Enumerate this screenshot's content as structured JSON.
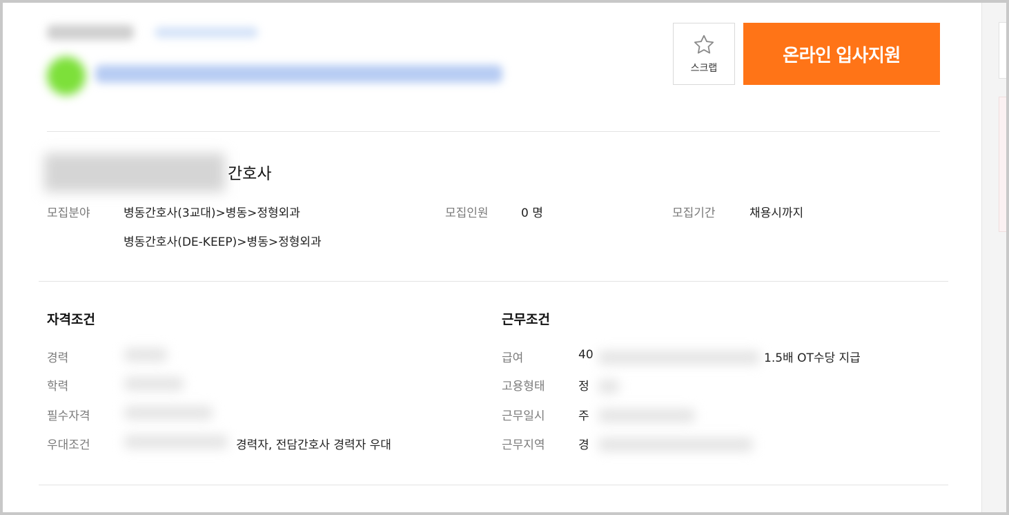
{
  "actions": {
    "scrap_label": "스크랩",
    "apply_label": "온라인 입사지원"
  },
  "job": {
    "title_suffix": "간호사"
  },
  "recruit": {
    "field_label": "모집분야",
    "field_values": [
      "병동간호사(3교대)>병동>정형외과",
      "병동간호사(DE-KEEP)>병동>정형외과"
    ],
    "headcount_label": "모집인원",
    "headcount_value": "0 명",
    "period_label": "모집기간",
    "period_value": "채용시까지"
  },
  "qualifications": {
    "title": "자격조건",
    "career_label": "경력",
    "education_label": "학력",
    "required_label": "필수자격",
    "preferred_label": "우대조건",
    "preferred_visible": "경력자, 전담간호사 경력자 우대"
  },
  "conditions": {
    "title": "근무조건",
    "salary_label": "급여",
    "salary_prefix": "40",
    "salary_suffix": "1.5배 OT수당 지급",
    "employment_label": "고용형태",
    "employment_prefix": "정",
    "hours_label": "근무일시",
    "hours_prefix": "주",
    "location_label": "근무지역",
    "location_prefix": "경"
  },
  "colors": {
    "accent": "#ff7417",
    "label": "#7a7a7a",
    "text": "#222222"
  },
  "icons": {
    "scrap": "star-outline-icon"
  }
}
